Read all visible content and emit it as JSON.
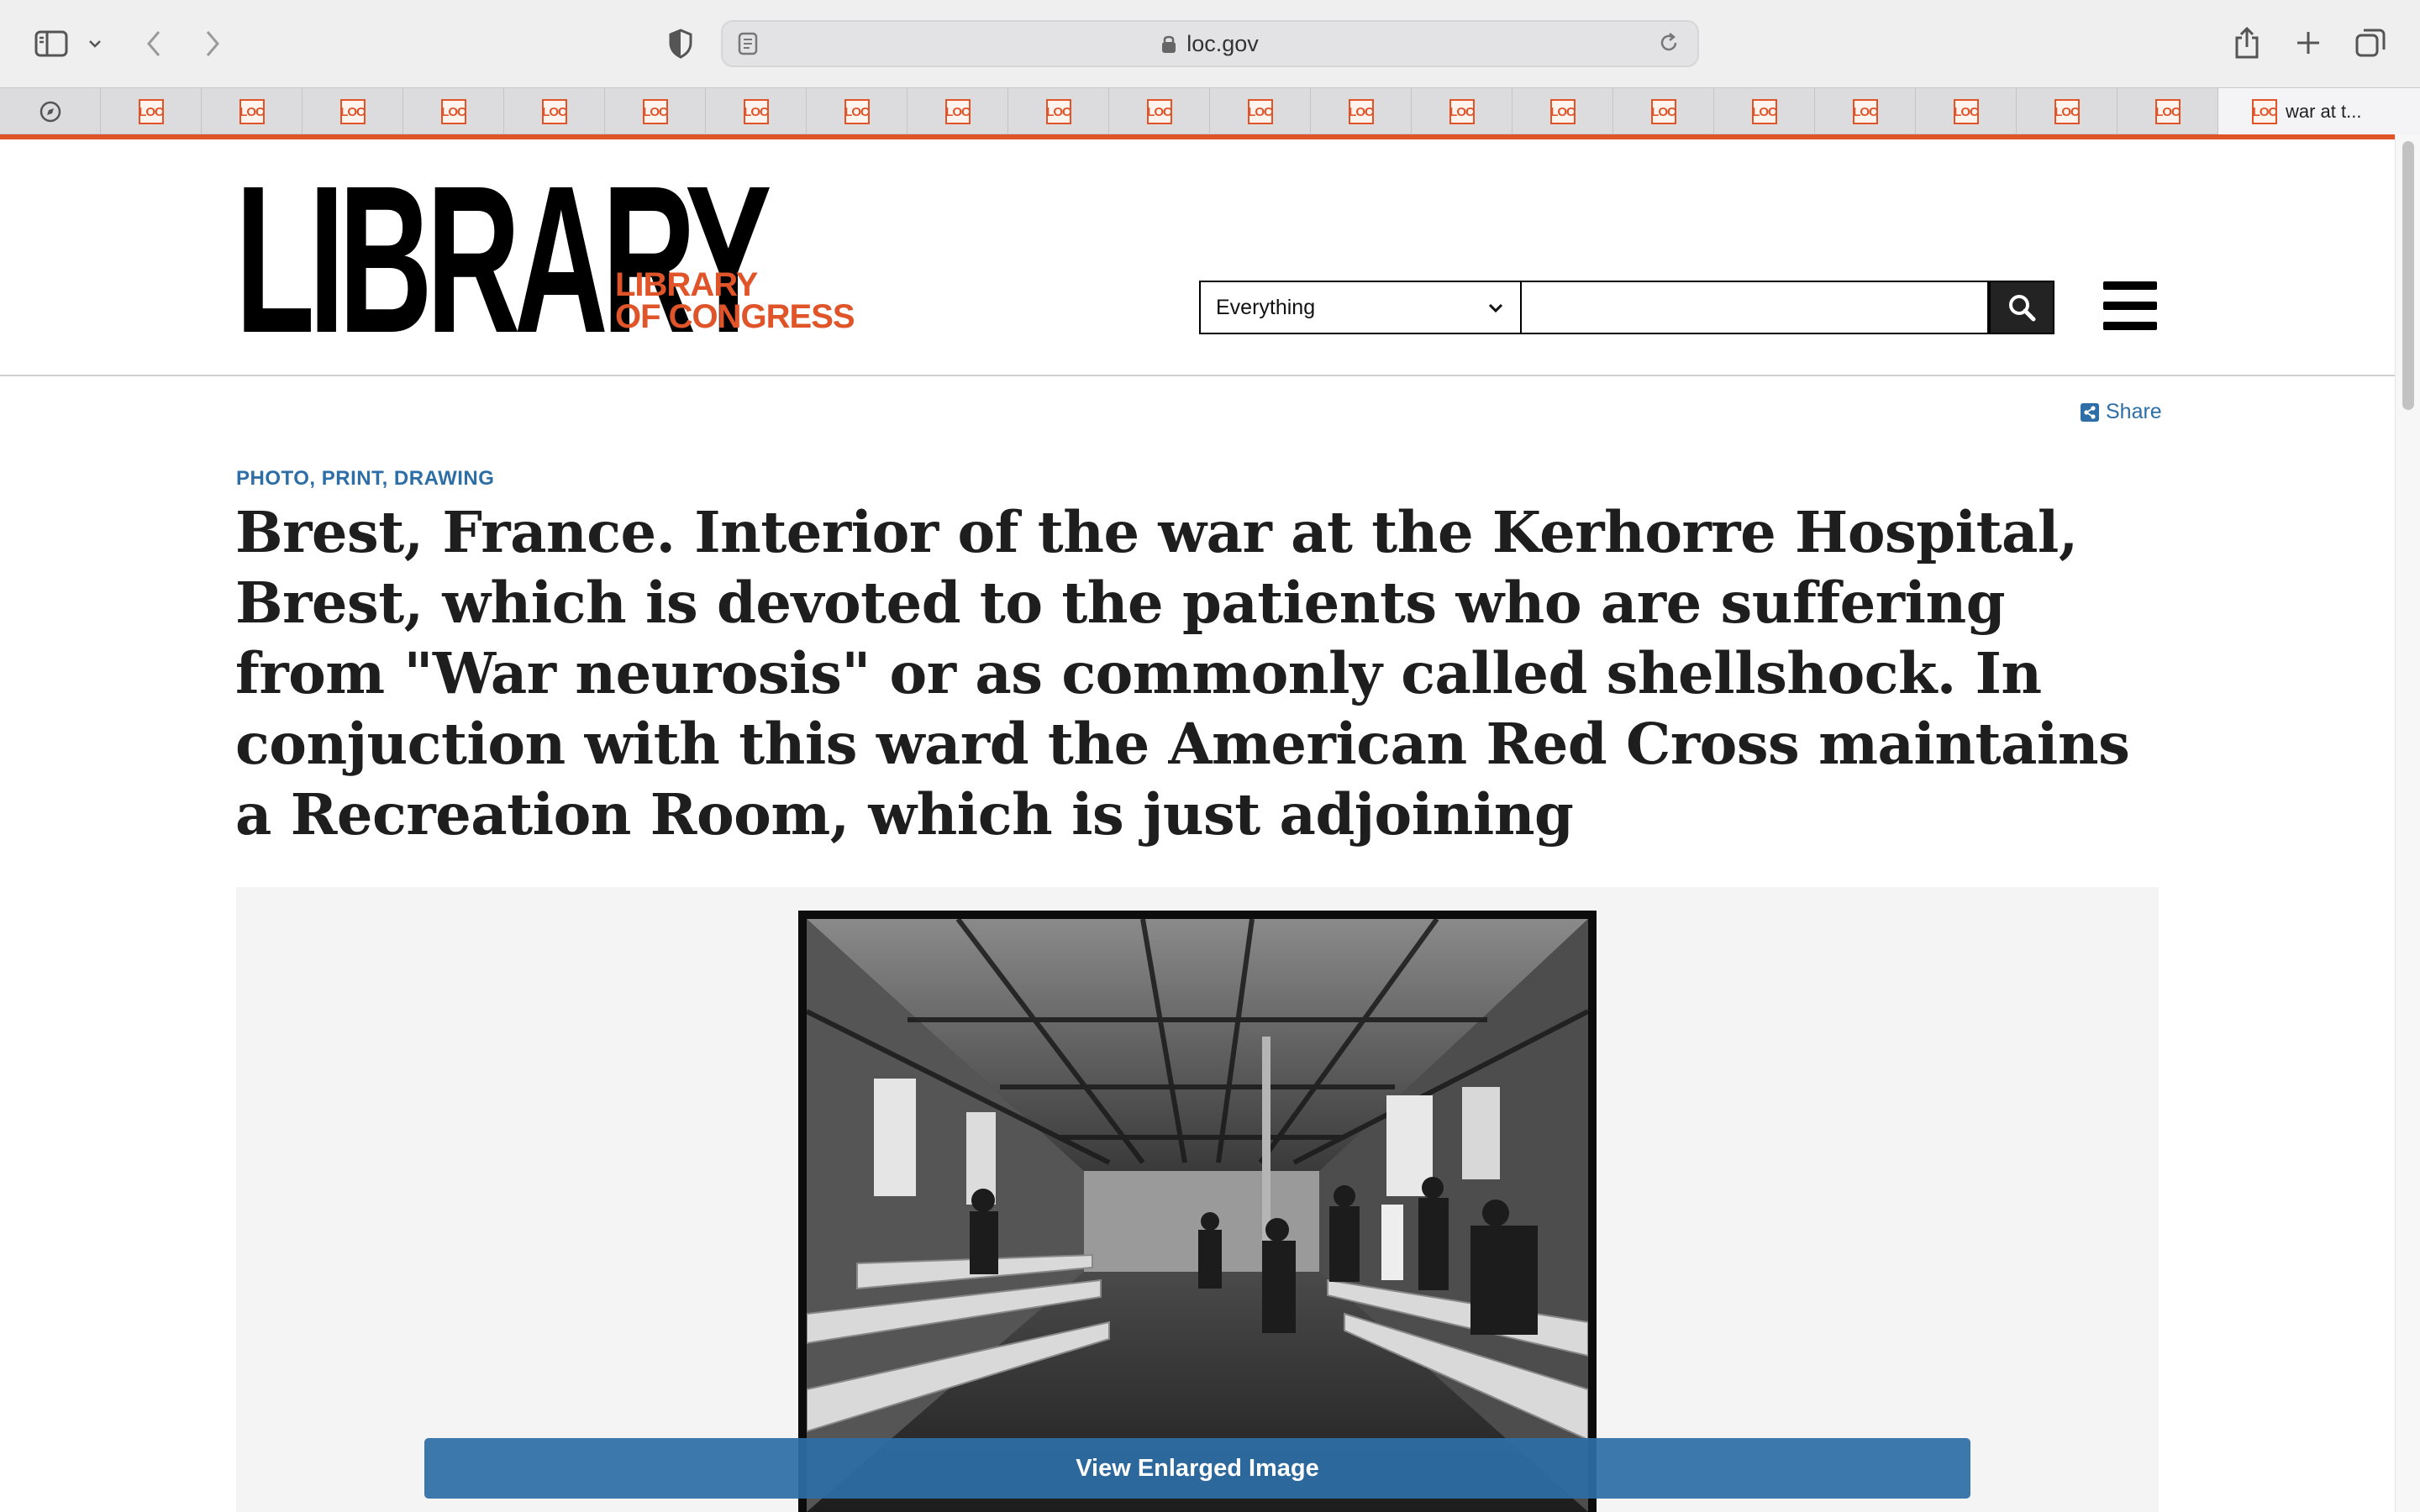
{
  "browser": {
    "url": "loc.gov",
    "tab_count_loc": 21,
    "active_tab_title": "war at t...",
    "tab_favicon_text": "LOC"
  },
  "site": {
    "logo_big": "LIBRARY",
    "logo_small_line1": "LIBRARY",
    "logo_small_line2": "OF CONGRESS",
    "brand_color": "#e0542a",
    "link_color": "#2e6ea6"
  },
  "search": {
    "scope_selected": "Everything",
    "query": "",
    "placeholder": ""
  },
  "page": {
    "share_label": "Share",
    "category": "PHOTO, PRINT, DRAWING",
    "title": "Brest, France. Interior of the war at the Kerhorre Hospital, Brest, which is devoted to the patients who are suffering from \"War neurosis\" or as commonly called shellshock. In conjuction with this ward the American Red Cross maintains a Recreation Room, which is just adjoining",
    "enlarge_label": "View Enlarged Image"
  },
  "icons": {
    "sidebar": "sidebar-icon",
    "back": "chevron-left-icon",
    "forward": "chevron-right-icon",
    "privacy": "shield-icon",
    "lock": "lock-icon",
    "reader": "reader-icon",
    "reload": "reload-icon",
    "share": "share-icon",
    "new_tab": "plus-icon",
    "tabs": "tabs-overview-icon",
    "search": "magnifier-icon",
    "menu": "hamburger-icon"
  }
}
